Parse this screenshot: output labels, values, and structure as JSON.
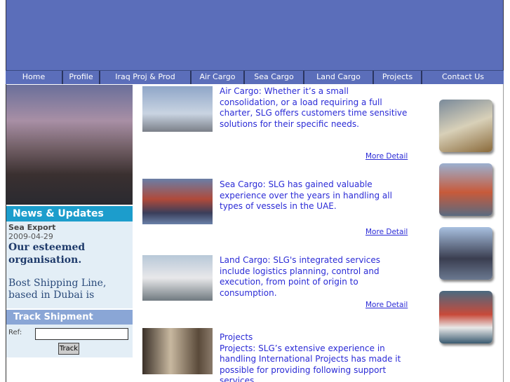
{
  "nav": [
    "Home",
    "Profile",
    "Iraq Proj & Prod",
    "Air Cargo",
    "Sea Cargo",
    "Land Cargo",
    "Projects",
    "Contact Us"
  ],
  "news": {
    "heading": "News & Updates",
    "title": "Sea Export",
    "date": "2009-04-29",
    "headline": "Our esteemed organisation.",
    "body": "Bost Shipping Line, based in Dubai is"
  },
  "track": {
    "heading": "Track Shipment",
    "ref_label": "Ref:",
    "ref_value": "",
    "button": "Track"
  },
  "services": [
    {
      "text": "Air Cargo: Whether it’s a small consolidation, or a load requiring a full charter, SLG offers customers time sensitive solutions for their specific needs.",
      "more": "More Detail"
    },
    {
      "text": "Sea Cargo: SLG has gained valuable experience over the years in handling all types of vessels in the UAE.",
      "more": "More Detail"
    },
    {
      "text": "Land Cargo: SLG's integrated services include logistics planning, control and execution, from point of origin to consumption.",
      "more": "More Detail"
    },
    {
      "title": "Projects",
      "text": "Projects: SLG’s extensive experience in handling International Projects has made it possible for providing following support services"
    }
  ]
}
